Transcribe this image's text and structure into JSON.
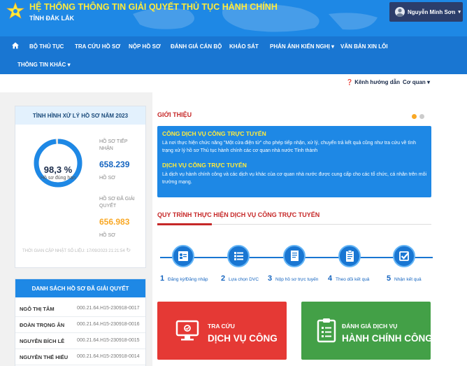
{
  "header": {
    "title": "HỆ THỐNG THÔNG TIN GIẢI QUYẾT THỦ TỤC HÀNH CHÍNH",
    "subtitle": "TỈNH ĐẮK LẮK",
    "user_name": "Nguyễn Minh Sơn"
  },
  "nav": {
    "items": [
      "BỘ THỦ TỤC",
      "TRA CỨU HỒ SƠ",
      "NỘP HỒ SƠ",
      "ĐÁNH GIÁ CÁN BỘ",
      "KHẢO SÁT",
      "PHẢN ÁNH KIẾN NGHỊ",
      "VĂN BẢN XIN LỖI",
      "THÔNG TIN KHÁC"
    ]
  },
  "topbar": {
    "guide": "Kênh hướng dẫn",
    "agency": "Cơ quan"
  },
  "stats": {
    "title": "TÌNH HÌNH XỬ LÝ HỒ SƠ NĂM 2023",
    "percent": "98,3 %",
    "percent_value": 98.3,
    "percent_label": "Hồ sơ đúng hạn",
    "received_label_1": "HỒ SƠ TIẾP",
    "received_label_2": "NHẬN",
    "received_value": "658.239",
    "received_unit": "HỒ SƠ",
    "resolved_label_1": "HỒ SƠ ĐÃ GIẢI",
    "resolved_label_2": "QUYẾT",
    "resolved_value": "656.983",
    "resolved_unit": "HỒ SƠ",
    "updated": "THỜI GIAN CẬP NHẬT SỐ LIỆU: 17/09/2023 21:21:54"
  },
  "resolved_list": {
    "title": "DANH SÁCH HỒ SƠ ĐÃ GIẢI QUYẾT",
    "rows": [
      {
        "name": "NGÔ THỊ TÂM",
        "code": "000.21.64.H15-230918-0017"
      },
      {
        "name": "ĐOÀN TRỌNG ÂN",
        "code": "000.21.64.H15-230918-0016"
      },
      {
        "name": "NGUYỄN BÍCH LỄ",
        "code": "000.21.64.H15-230918-0015"
      },
      {
        "name": "NGUYỄN THẾ HIẾU",
        "code": "000.21.64.H15-230918-0014"
      }
    ]
  },
  "intro": {
    "title": "GIỚI THIỆU",
    "box_title_1": "CÔNG DỊCH VỤ CÔNG TRỰC TUYẾN",
    "box_text_1": "Là nơi thực hiện chức năng \"Một cửa điện tử\" cho phép tiếp nhận, xử lý, chuyển trả kết quả cũng như tra cứu về tình trạng xử lý hồ sơ Thủ tục hành chính các cơ quan nhà nước Tỉnh thành",
    "box_title_2": "DỊCH VỤ CÔNG TRỰC TUYẾN",
    "box_text_2": "Là dịch vụ hành chính công và các dịch vụ khác của cơ quan nhà nước được cung cấp cho các tổ chức, cá nhân trên môi trường mạng."
  },
  "process": {
    "title": "QUY TRÌNH THỰC HIỆN DỊCH VỤ CÔNG TRỰC TUYẾN",
    "steps": [
      {
        "num": "1",
        "label": "Đăng ký/Đăng nhập"
      },
      {
        "num": "2",
        "label": "Lựa chọn DVC"
      },
      {
        "num": "3",
        "label": "Nộp hồ sơ trực tuyến"
      },
      {
        "num": "4",
        "label": "Theo dõi kết quả"
      },
      {
        "num": "5",
        "label": "Nhận kết quả"
      }
    ]
  },
  "actions": {
    "lookup_small": "TRA CỨU",
    "lookup_big": "DỊCH VỤ CÔNG",
    "rate_small": "ĐÁNH GIÁ DỊCH VỤ",
    "rate_big": "HÀNH CHÍNH CÔNG"
  },
  "colors": {
    "primary": "#1e88e5",
    "nav": "#1976d2",
    "accent_red": "#c62828",
    "title_yellow": "#ffeb3b"
  }
}
